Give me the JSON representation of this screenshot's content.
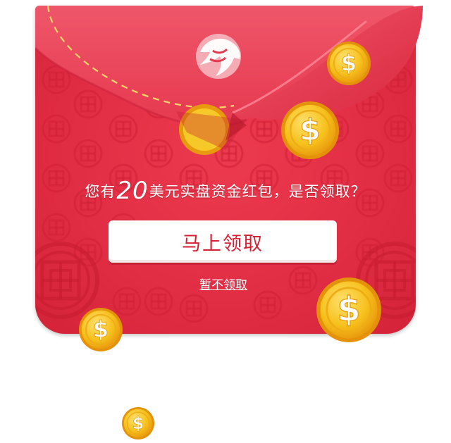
{
  "envelope": {
    "prompt_before": "您有",
    "amount": "20",
    "prompt_after": "美元实盘资金红包，是否领取？",
    "claim_label": "马上领取",
    "later_label": "暂不领取"
  },
  "colors": {
    "envelope_red": "#e22e44",
    "flap_red": "#eb4b5e",
    "button_text": "#d42035",
    "coin_gold": "#f5c21c",
    "coin_rim": "#e89a0e"
  },
  "icons": {
    "logo": "eagle-icon",
    "coin": "dollar-coin-icon"
  }
}
